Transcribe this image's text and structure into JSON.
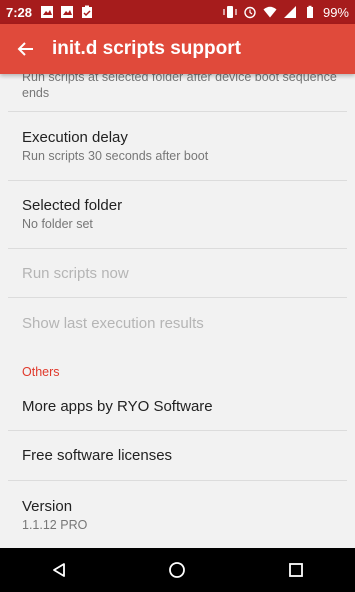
{
  "status_bar": {
    "time": "7:28",
    "left_icons": [
      "image-icon",
      "image-icon",
      "clipboard-check-icon"
    ],
    "right_icons": [
      "vibrate-icon",
      "alarm-icon",
      "wifi-icon",
      "signal-icon",
      "battery-icon"
    ],
    "battery": "99%"
  },
  "toolbar": {
    "title": "init.d scripts support",
    "back_icon": "back-arrow-icon",
    "color": "#e04a3b"
  },
  "settings": {
    "run_after_boot": {
      "summary": "Run scripts at selected folder after device boot sequence ends",
      "checked": true
    },
    "execution_delay": {
      "title": "Execution delay",
      "summary": "Run scripts 30 seconds after boot"
    },
    "selected_folder": {
      "title": "Selected folder",
      "summary": "No folder set"
    },
    "run_now": {
      "title": "Run scripts now",
      "enabled": false
    },
    "show_results": {
      "title": "Show last execution results",
      "enabled": false
    },
    "others_header": "Others",
    "more_apps": {
      "title": "More apps by RYO Software"
    },
    "licenses": {
      "title": "Free software licenses"
    },
    "version": {
      "title": "Version",
      "summary": "1.1.12 PRO"
    }
  },
  "navigation": {
    "buttons": [
      "back-triangle-icon",
      "home-circle-icon",
      "recents-square-icon"
    ]
  },
  "colors": {
    "accent": "#e03a2c",
    "status_bar": "#a61c1c"
  }
}
